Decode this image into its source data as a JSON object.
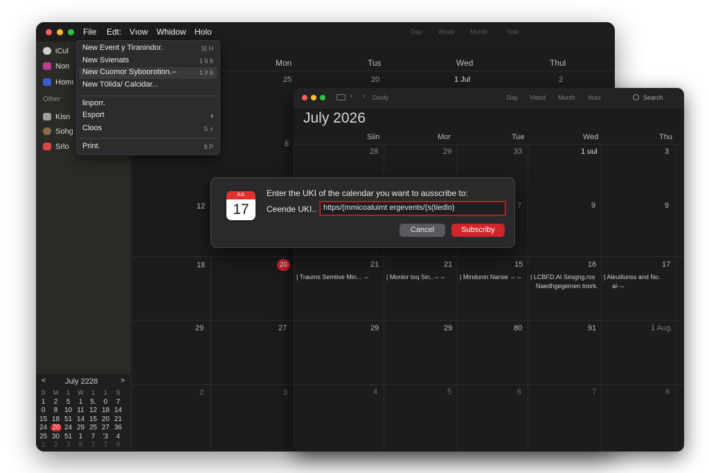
{
  "back_window": {
    "menu": [
      "File",
      "Edt:",
      "Vıow",
      "Whidow",
      "Holo"
    ],
    "segments": [
      "Day",
      "Week",
      "Month",
      "Year"
    ],
    "sidebar": {
      "items": [
        {
          "label": "iCul",
          "color": "#cfcfcf"
        },
        {
          "label": "Non",
          "color": "#c03c8c"
        },
        {
          "label": "Homı",
          "color": "#3b5bd8"
        }
      ],
      "other_header": "Other",
      "other_items": [
        {
          "label": "Kisn",
          "color": "#a0a0a0"
        },
        {
          "label": "Sohg",
          "color": "#8a6a4a"
        },
        {
          "label": "Srlo",
          "color": "#d84848"
        }
      ]
    },
    "day_heads": [
      "Mon",
      "Tus",
      "Wed",
      "Thul"
    ],
    "top_nums": [
      "25",
      "20",
      "1 Jul",
      "2"
    ],
    "row_nums_left": [
      "6",
      "12",
      "18",
      "29",
      "2"
    ],
    "row_nums_second": [
      "27",
      "3"
    ],
    "mini_cal": {
      "title": "July 2228",
      "prev": "<",
      "next": ">",
      "weekdays": [
        "S",
        "M",
        "1",
        "W",
        "1",
        "1",
        "S"
      ],
      "rows": [
        [
          "1",
          "2",
          "5",
          "1",
          "5.",
          "0",
          "7"
        ],
        [
          "0",
          "8",
          "10",
          "11",
          "12",
          "18",
          "14"
        ],
        [
          "15",
          "18",
          "51",
          "14",
          "15",
          "20",
          "21"
        ],
        [
          "24",
          "20",
          "24",
          "29",
          "25",
          "27",
          "36"
        ],
        [
          "25",
          "30",
          "51",
          "1",
          "7",
          "'3",
          "4"
        ],
        [
          "1",
          "2",
          "3",
          "9",
          "7",
          "7",
          "9"
        ]
      ],
      "today": "20"
    }
  },
  "file_menu": {
    "items": [
      {
        "label": "New Event y Tiranindor.",
        "key": "S| H"
      },
      {
        "label": "New Svienats",
        "key": "1 6 6"
      },
      {
        "label": "New Cuomor Syboorotion.--",
        "key": "1 # 6"
      },
      {
        "label": "New T0lida/ Calcidar...",
        "key": ""
      },
      {
        "label": "linporr.",
        "key": ""
      },
      {
        "label": "Esport",
        "key": "›"
      },
      {
        "label": "Cloos",
        "key": "S ⌽"
      },
      {
        "label": "Print.",
        "key": "8 P"
      }
    ]
  },
  "front_window": {
    "breadcrumb": "Dooly",
    "segments": [
      "Day",
      "Vleed",
      "Month",
      "Yeas"
    ],
    "search": "Search",
    "month_title": "July 2026",
    "day_heads": [
      "Siin",
      "Mor",
      "Tue",
      "Wed",
      "Thu"
    ],
    "row1": [
      "28",
      "29",
      "33",
      "1 uul",
      "3"
    ],
    "row2_right": [
      "7",
      "9",
      "9"
    ],
    "row3": [
      "21",
      "21",
      "15",
      "16",
      "17"
    ],
    "row4": [
      "29",
      "29",
      "80",
      "91",
      "1 Aug."
    ],
    "row5": [
      "4",
      "5",
      "6",
      "7",
      "6"
    ],
    "events": [
      "| Traums Semtive Min... ⇔",
      "| Monior ⁠toq Sin..⇔⇔",
      "| Mindunin Narsie ⇔⇔",
      "| LCBFD.AI Sesgng.ros",
      "Naedhgegernen tnork.",
      "| Aleulilunss and No.",
      "al-⇔"
    ]
  },
  "back_grid": {
    "row3_left": [
      "18"
    ],
    "row3_today": "20",
    "row4_left": [
      "29",
      "27"
    ],
    "row5_left": [
      "2",
      "3"
    ]
  },
  "dialog": {
    "icon_month": "JUL",
    "icon_day": "17",
    "prompt": "Enter the UKI of the calendar you want to ausscribe to:",
    "field_label": "Ceende UKI..",
    "field_value": "https/(mmicoaluimt ergevents/(s(tiedlo)",
    "cancel_label": "Cancel",
    "subscribe_label": "Subscriby"
  },
  "colors": {
    "accent": "#d0262b",
    "window_bg": "#1c1c1e",
    "sidebar_bg": "#2a2a26"
  }
}
